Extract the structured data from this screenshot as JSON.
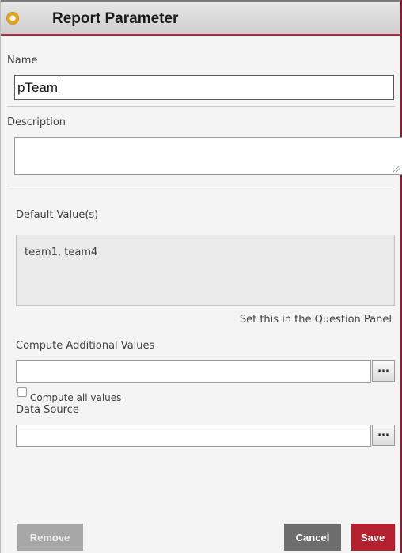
{
  "dialog": {
    "title": "Report Parameter",
    "title_icon": "gear-icon"
  },
  "fields": {
    "name_label": "Name",
    "name_value": "pTeam",
    "description_label": "Description",
    "description_value": "",
    "default_values_label": "Default Value(s)",
    "default_values_text": "team1, team4",
    "question_panel_note": "Set this in the Question Panel",
    "compute_additional_label": "Compute Additional Values",
    "compute_additional_value": "",
    "compute_all_label": "Compute all values",
    "compute_all_checked": false,
    "data_source_label": "Data Source",
    "data_source_value": "",
    "ellipsis_label": "..."
  },
  "buttons": {
    "remove": "Remove",
    "cancel": "Cancel",
    "save": "Save"
  },
  "colors": {
    "accent": "#b5202f",
    "cancel_bg": "#6d6d6d",
    "remove_bg": "#a7a7a7"
  }
}
